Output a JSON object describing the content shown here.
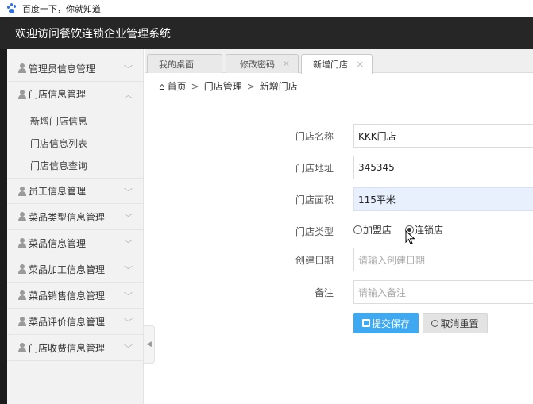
{
  "browser": {
    "title": "百度一下，你就知道"
  },
  "header": {
    "title": "欢迎访问餐饮连锁企业管理系统"
  },
  "sidebar": {
    "items": [
      {
        "label": "管理员信息管理"
      },
      {
        "label": "门店信息管理"
      },
      {
        "label": "员工信息管理"
      },
      {
        "label": "菜品类型信息管理"
      },
      {
        "label": "菜品信息管理"
      },
      {
        "label": "菜品加工信息管理"
      },
      {
        "label": "菜品销售信息管理"
      },
      {
        "label": "菜品评价信息管理"
      },
      {
        "label": "门店收费信息管理"
      }
    ],
    "subitems": [
      {
        "label": "新增门店信息"
      },
      {
        "label": "门店信息列表"
      },
      {
        "label": "门店信息查询"
      }
    ]
  },
  "tabs": [
    {
      "label": "我的桌面"
    },
    {
      "label": "修改密码"
    },
    {
      "label": "新增门店"
    }
  ],
  "breadcrumb": {
    "home": "首页",
    "section": "门店管理",
    "page": "新增门店"
  },
  "form": {
    "name_label": "门店名称",
    "name_value": "KKK门店",
    "address_label": "门店地址",
    "address_value": "345345",
    "area_label": "门店面积",
    "area_value": "115平米",
    "type_label": "门店类型",
    "type_option1": "加盟店",
    "type_option2": "连锁店",
    "type_selected": "连锁店",
    "date_label": "创建日期",
    "date_placeholder": "请输入创建日期",
    "note_label": "备注",
    "note_placeholder": "请输入备注",
    "submit_label": "提交保存",
    "reset_label": "取消重置"
  },
  "colors": {
    "header_bg": "#262626",
    "primary": "#3ea8f0"
  }
}
